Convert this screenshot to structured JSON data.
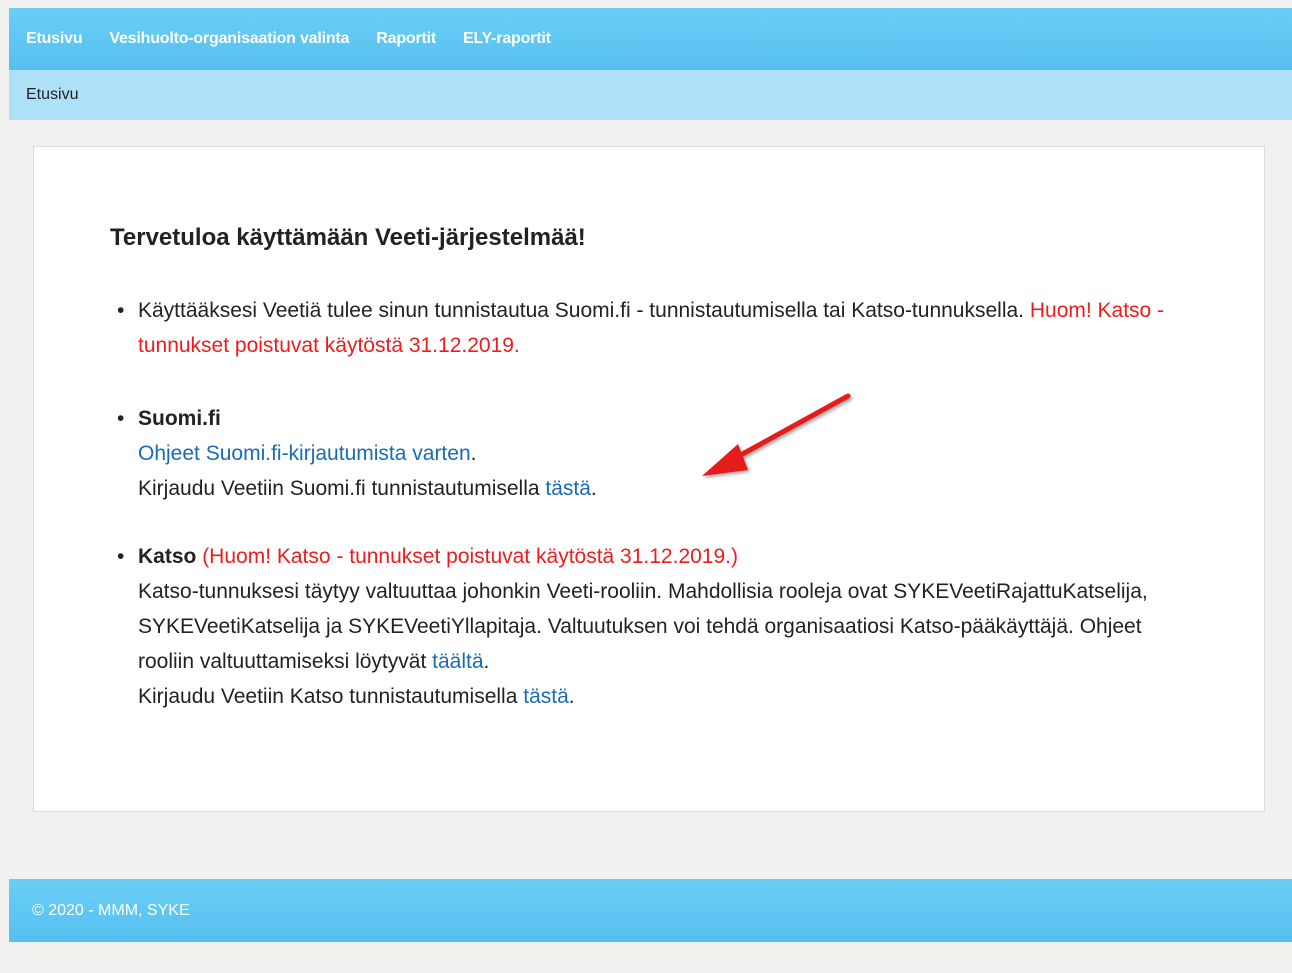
{
  "nav": {
    "items": [
      {
        "label": "Etusivu"
      },
      {
        "label": "Vesihuolto-organisaation valinta"
      },
      {
        "label": "Raportit"
      },
      {
        "label": "ELY-raportit"
      }
    ]
  },
  "breadcrumb": {
    "label": "Etusivu"
  },
  "main": {
    "welcome_title": "Tervetuloa käyttämään Veeti-järjestelmää!",
    "intro": {
      "text": "Käyttääksesi Veetiä tulee sinun tunnistautua Suomi.fi - tunnistautumisella tai Katso-tunnuksella. ",
      "warning": "Huom! Katso - tunnukset poistuvat käytöstä 31.12.2019."
    },
    "suomifi": {
      "heading": "Suomi.fi",
      "instructions_link": "Ohjeet Suomi.fi-kirjautumista varten",
      "instructions_suffix": ".",
      "login_text": "Kirjaudu Veetiin Suomi.fi tunnistautumisella ",
      "login_link": "tästä",
      "login_suffix": "."
    },
    "katso": {
      "heading": "Katso",
      "warning": " (Huom! Katso - tunnukset poistuvat käytöstä 31.12.2019.)",
      "body": "Katso-tunnuksesi täytyy valtuuttaa johonkin Veeti-rooliin. Mahdollisia rooleja ovat SYKEVeetiRajattuKatselija, SYKEVeetiKatselija ja SYKEVeetiYllapitaja. Valtuutuksen voi tehdä organisaatiosi Katso-pääkäyttäjä. Ohjeet rooliin valtuuttamiseksi löytyvät ",
      "guide_link": "täältä",
      "guide_suffix": ".",
      "login_text": "Kirjaudu Veetiin Katso tunnistautumisella ",
      "login_link": "tästä",
      "login_suffix": "."
    }
  },
  "footer": {
    "text": "© 2020 - MMM, SYKE"
  },
  "colors": {
    "nav_bg": "#5ec6f3",
    "breadcrumb_bg": "#aee0f8",
    "warning_red": "#ee1c1c",
    "link_blue": "#1a6bb5",
    "annotation_arrow": "#e51a1a"
  },
  "icons": {
    "annotation": "red-arrow-icon"
  }
}
